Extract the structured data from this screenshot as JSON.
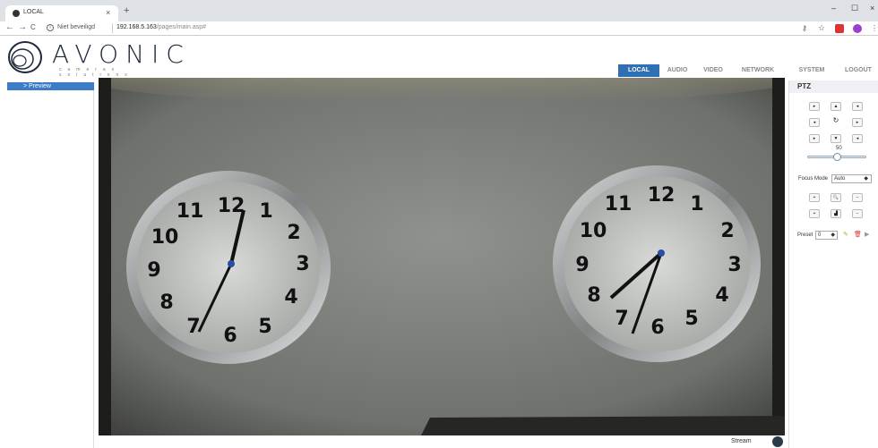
{
  "browser": {
    "tab_title": "LOCAL",
    "tab_close": "×",
    "new_tab": "+",
    "win_min": "–",
    "win_max": "☐",
    "win_close": "×",
    "back": "←",
    "forward": "→",
    "reload": "C",
    "insecure_label": "Niet beveiligd",
    "url_host": "192.168.5.163",
    "url_path": "/pages/main.asp#",
    "key_icon": "⚷",
    "star_icon": "☆"
  },
  "header": {
    "logo_text": "AVONIC",
    "logo_sub": "cameras  solutions",
    "nav": [
      {
        "label": "LOCAL",
        "active": true
      },
      {
        "label": "AUDIO",
        "active": false
      },
      {
        "label": "VIDEO",
        "active": false
      },
      {
        "label": "NETWORK",
        "active": false
      },
      {
        "label": "SYSTEM",
        "active": false
      },
      {
        "label": "LOGOUT",
        "active": false
      }
    ]
  },
  "sidebar": {
    "items": [
      {
        "label": "> Preview"
      }
    ]
  },
  "video": {
    "stream_label": "Stream"
  },
  "ptz": {
    "title": "PTZ",
    "speed_value": "50",
    "speed_fraction": 0.5,
    "focus_label": "Focus Mode",
    "focus_value": "Auto",
    "preset_label": "Preset",
    "preset_value": "0",
    "icons": {
      "up_left": "▸",
      "up": "▲",
      "up_right": "◂",
      "left": "◂",
      "home": "↻",
      "right": "▸",
      "down_left": "▸",
      "down": "▼",
      "down_right": "◂",
      "zoom_in": "+",
      "zoom": "🔍",
      "zoom_out": "−",
      "focus_near": "+",
      "focus": "▟",
      "focus_far": "−",
      "set": "✎",
      "delete": "🗑",
      "call": "▶"
    }
  },
  "colors": {
    "accent": "#2f6fb3",
    "sidebar_active": "#3c7cc6"
  }
}
